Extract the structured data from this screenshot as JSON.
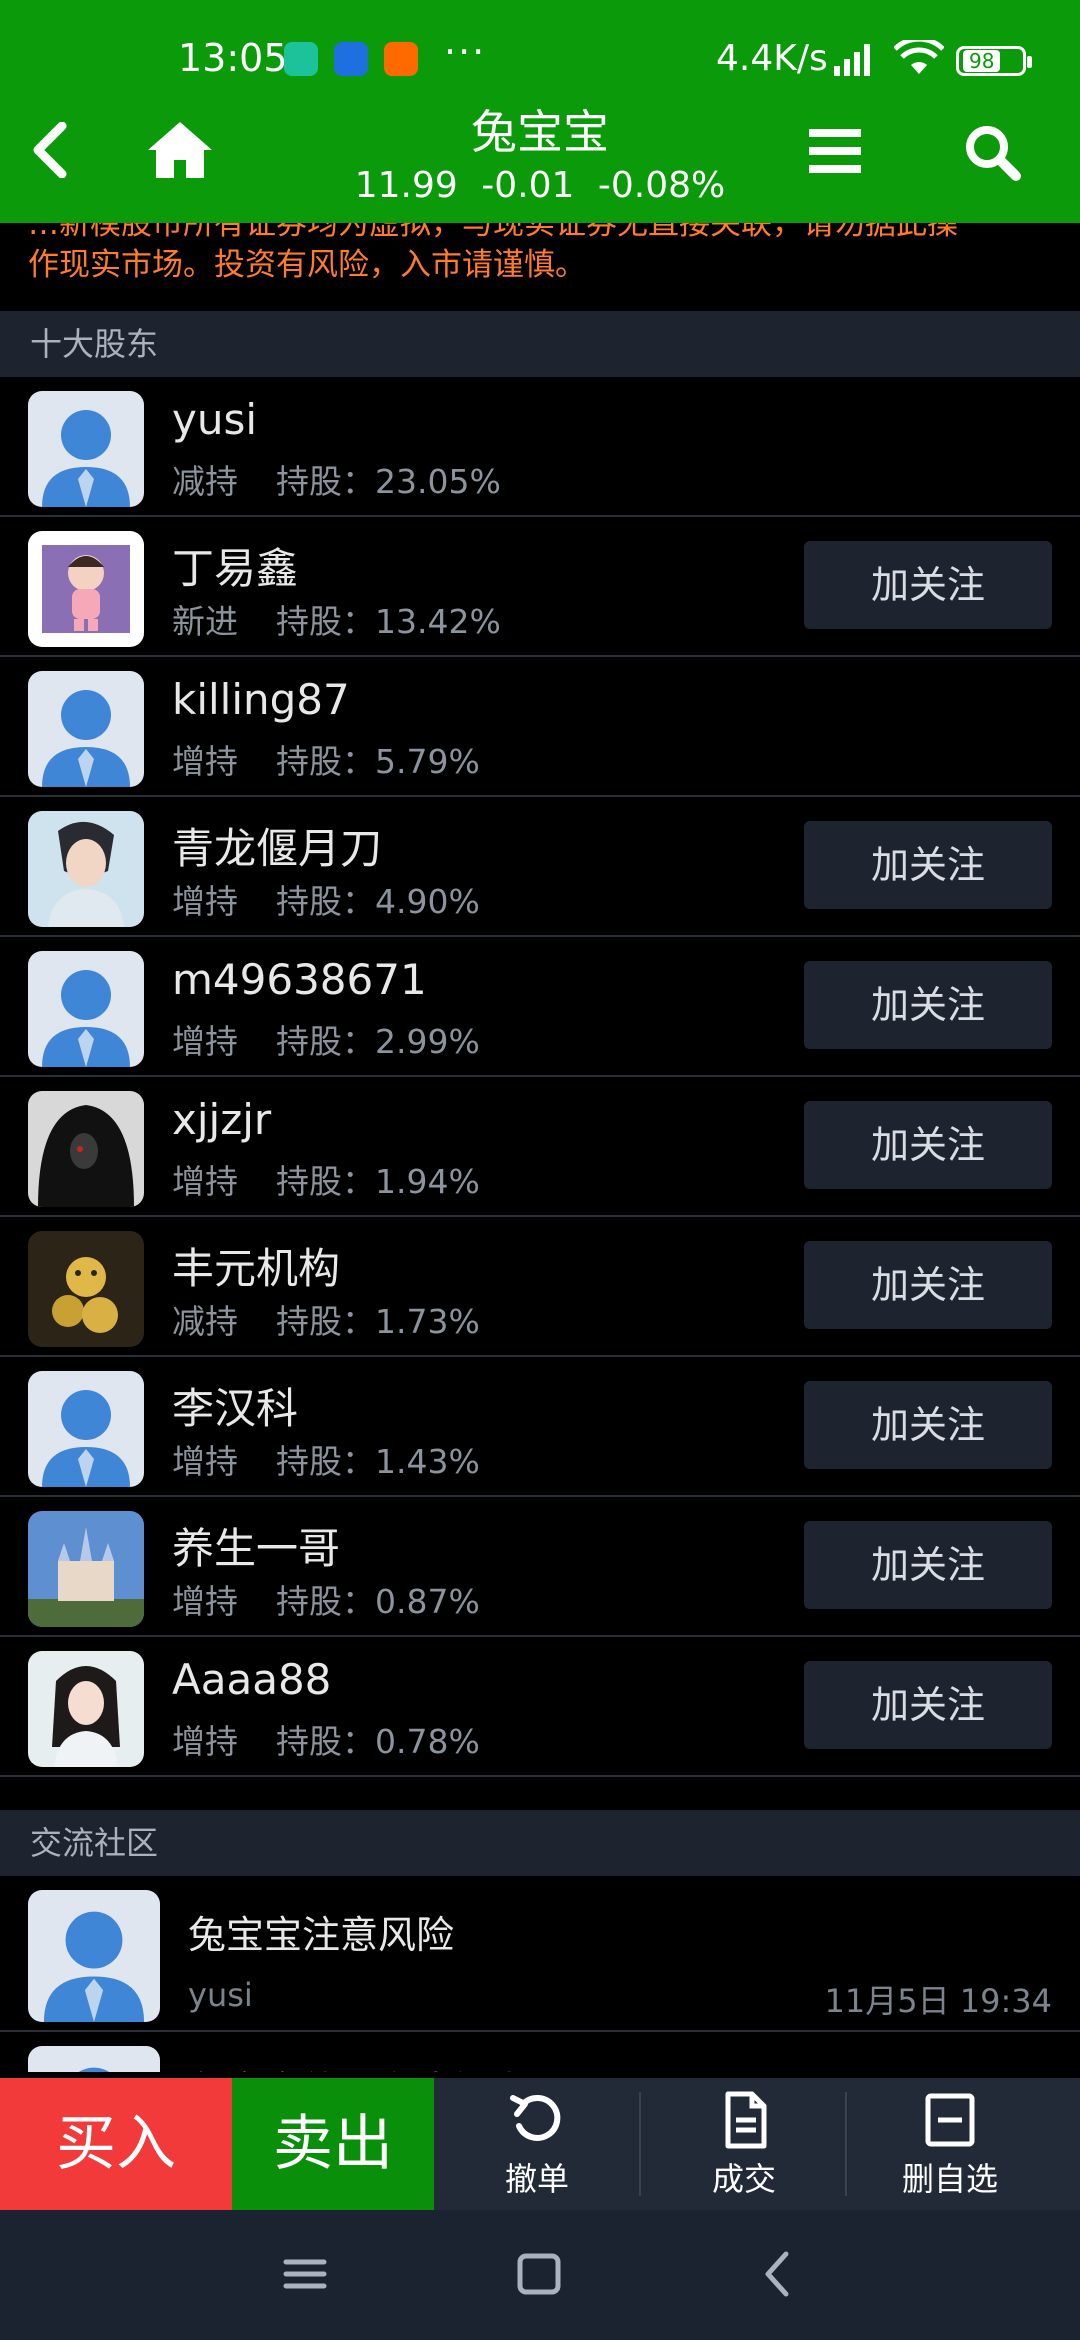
{
  "status_bar": {
    "time": "13:05",
    "network_speed": "4.4K/s",
    "battery": "98",
    "colors": {
      "app1": "#1bc29a",
      "app2": "#1e6fe0",
      "app3": "#ff6a00"
    }
  },
  "header": {
    "stock_name": "兔宝宝",
    "price": "11.99",
    "change": "-0.01",
    "change_pct": "-0.08%",
    "background": "#0a9a0a"
  },
  "disclaimer": {
    "partial_line": "…新模股市所有证券均为虚拟，与现实证券无直接关联，请勿据此操",
    "line": "作现实市场。投资有风险，入市请谨慎。"
  },
  "shareholders": {
    "section_title": "十大股东",
    "follow_label": "加关注",
    "share_label": "持股：",
    "items": [
      {
        "name": "yusi",
        "action": "减持",
        "pct": "23.05%",
        "followable": false,
        "avatar": "default-avatar"
      },
      {
        "name": "丁易鑫",
        "action": "新进",
        "pct": "13.42%",
        "followable": true,
        "avatar": "cartoon-girl-avatar"
      },
      {
        "name": "killing87",
        "action": "增持",
        "pct": "5.79%",
        "followable": false,
        "avatar": "default-avatar"
      },
      {
        "name": "青龙偃月刀",
        "action": "增持",
        "pct": "4.90%",
        "followable": true,
        "avatar": "anime-man-avatar"
      },
      {
        "name": "m49638671",
        "action": "增持",
        "pct": "2.99%",
        "followable": true,
        "avatar": "default-avatar"
      },
      {
        "name": "xjjzjr",
        "action": "增持",
        "pct": "1.94%",
        "followable": true,
        "avatar": "dark-portrait-avatar"
      },
      {
        "name": "丰元机构",
        "action": "减持",
        "pct": "1.73%",
        "followable": true,
        "avatar": "gold-figure-avatar"
      },
      {
        "name": "李汉科",
        "action": "增持",
        "pct": "1.43%",
        "followable": true,
        "avatar": "default-avatar"
      },
      {
        "name": "养生一哥",
        "action": "增持",
        "pct": "0.87%",
        "followable": true,
        "avatar": "castle-avatar"
      },
      {
        "name": "Aaaa88",
        "action": "增持",
        "pct": "0.78%",
        "followable": true,
        "avatar": "woman-portrait-avatar"
      }
    ]
  },
  "community": {
    "section_title": "交流社区",
    "posts": [
      {
        "title": "兔宝宝注意风险",
        "author": "yusi",
        "time": "11月5日 19:34"
      },
      {
        "title": "兔宝宝的股东告知书"
      }
    ]
  },
  "bottom_bar": {
    "buy": "买入",
    "sell": "卖出",
    "cancel": "撤单",
    "deals": "成交",
    "remove_watch": "删自选",
    "buy_color": "#f23a3a",
    "sell_color": "#0a8f0a"
  }
}
